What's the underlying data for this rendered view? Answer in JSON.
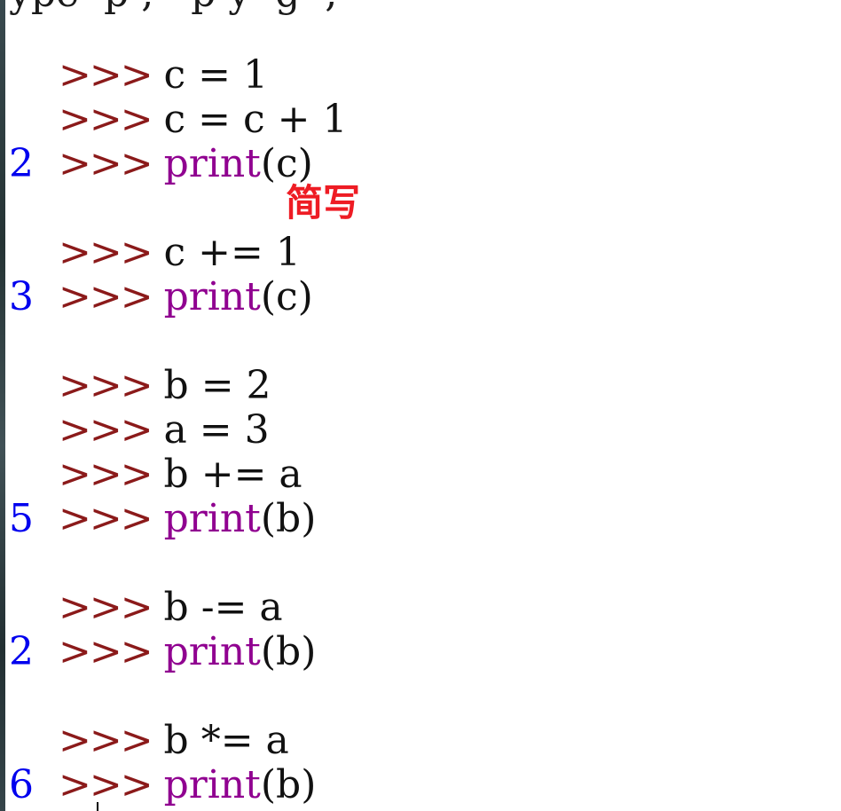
{
  "header_fragment": "ype  p ,   p y  g  ,",
  "prompt": ">>>",
  "lines": [
    {
      "kind": "input",
      "code": " c = 1",
      "builtin": ""
    },
    {
      "kind": "input",
      "code": " c = c + 1",
      "builtin": ""
    },
    {
      "kind": "input",
      "code": " ",
      "builtin": "print",
      "args": "(c)"
    },
    {
      "kind": "output",
      "text": "2"
    },
    {
      "kind": "input",
      "code": " c += 1",
      "builtin": ""
    },
    {
      "kind": "input",
      "code": " ",
      "builtin": "print",
      "args": "(c)"
    },
    {
      "kind": "output",
      "text": "3"
    },
    {
      "kind": "input",
      "code": " b = 2",
      "builtin": ""
    },
    {
      "kind": "input",
      "code": " a = 3",
      "builtin": ""
    },
    {
      "kind": "input",
      "code": " b += a",
      "builtin": ""
    },
    {
      "kind": "input",
      "code": " ",
      "builtin": "print",
      "args": "(b)"
    },
    {
      "kind": "output",
      "text": "5"
    },
    {
      "kind": "input",
      "code": " b -= a",
      "builtin": ""
    },
    {
      "kind": "input",
      "code": " ",
      "builtin": "print",
      "args": "(b)"
    },
    {
      "kind": "output",
      "text": "2"
    },
    {
      "kind": "input",
      "code": " b *= a",
      "builtin": ""
    },
    {
      "kind": "input",
      "code": " ",
      "builtin": "print",
      "args": "(b)"
    },
    {
      "kind": "output",
      "text": "6"
    }
  ],
  "annotation": "简写",
  "colors": {
    "prompt": "#8b1a1a",
    "code": "#111111",
    "builtin": "#900090",
    "output": "#0000ee",
    "annotation": "#ee1c24"
  }
}
